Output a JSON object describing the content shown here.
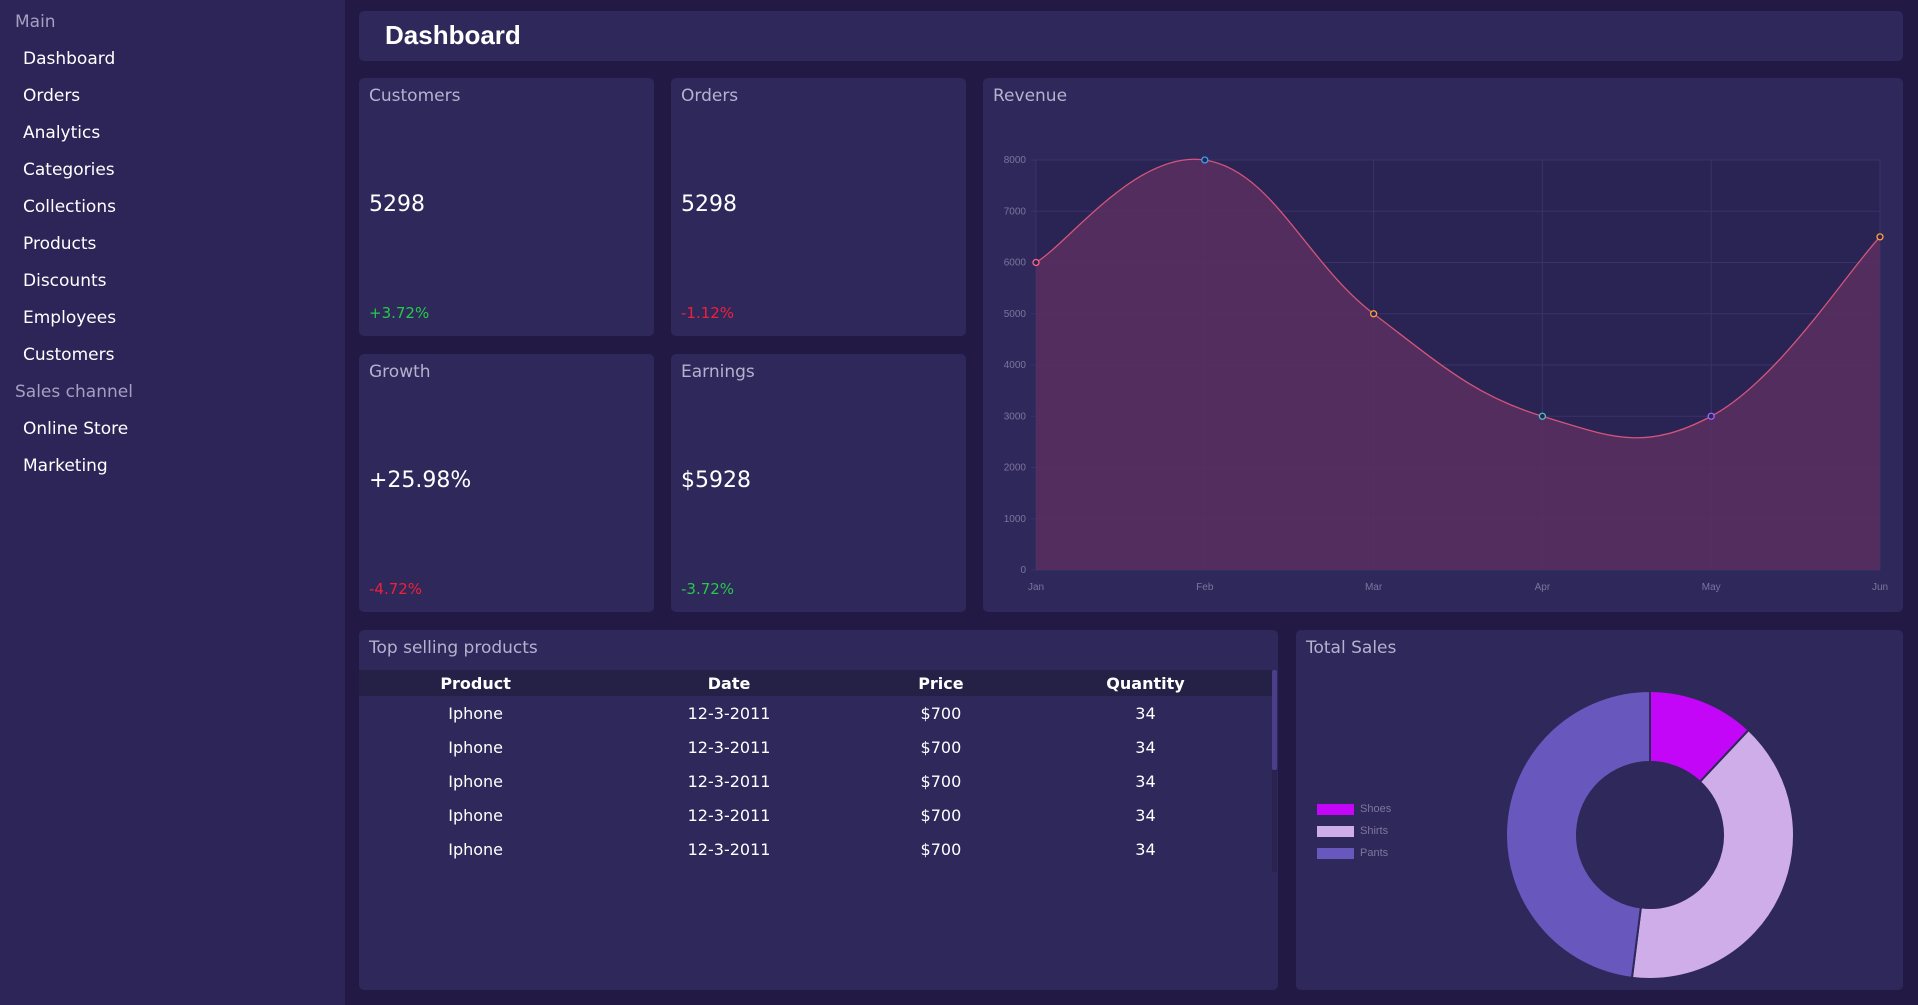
{
  "sidebar": {
    "sections": [
      {
        "title": "Main",
        "items": [
          "Dashboard",
          "Orders",
          "Analytics",
          "Categories",
          "Collections",
          "Products",
          "Discounts",
          "Employees",
          "Customers"
        ]
      },
      {
        "title": "Sales channel",
        "items": [
          "Online Store",
          "Marketing"
        ]
      }
    ]
  },
  "header": {
    "title": "Dashboard"
  },
  "stats": [
    {
      "title": "Customers",
      "value": "5298",
      "change": "+3.72%",
      "trend": "positive"
    },
    {
      "title": "Orders",
      "value": "5298",
      "change": "-1.12%",
      "trend": "negative"
    },
    {
      "title": "Growth",
      "value": "+25.98%",
      "change": "-4.72%",
      "trend": "negative"
    },
    {
      "title": "Earnings",
      "value": "$5928",
      "change": "-3.72%",
      "trend": "positive"
    }
  ],
  "revenue": {
    "title": "Revenue"
  },
  "top_products": {
    "title": "Top selling products",
    "columns": [
      "Product",
      "Date",
      "Price",
      "Quantity"
    ],
    "rows": [
      [
        "Iphone",
        "12-3-2011",
        "$700",
        "34"
      ],
      [
        "Iphone",
        "12-3-2011",
        "$700",
        "34"
      ],
      [
        "Iphone",
        "12-3-2011",
        "$700",
        "34"
      ],
      [
        "Iphone",
        "12-3-2011",
        "$700",
        "34"
      ],
      [
        "Iphone",
        "12-3-2011",
        "$700",
        "34"
      ]
    ]
  },
  "total_sales": {
    "title": "Total Sales"
  },
  "colors": {
    "positive": "#26c94a",
    "negative": "#f0203c",
    "line": "#d2557a",
    "fill": "#5a2f60",
    "shoes": "#c306f7",
    "shirts": "#ceade9",
    "pants": "#6857bc"
  },
  "chart_data": [
    {
      "type": "area",
      "title": "Revenue",
      "categories": [
        "Jan",
        "Feb",
        "Mar",
        "Apr",
        "May",
        "Jun"
      ],
      "values": [
        6000,
        8000,
        5000,
        3000,
        3000,
        6500
      ],
      "point_colors": [
        "#ff6384",
        "#36a2eb",
        "#ff9f40",
        "#4bc0c0",
        "#9966ff",
        "#ff9f40"
      ],
      "ylim": [
        0,
        8000
      ],
      "yticks": [
        0,
        1000,
        2000,
        3000,
        4000,
        5000,
        6000,
        7000,
        8000
      ],
      "grid": true
    },
    {
      "type": "pie",
      "style": "doughnut",
      "title": "Total Sales",
      "labels": [
        "Shoes",
        "Shirts",
        "Pants"
      ],
      "values": [
        12,
        40,
        48
      ],
      "legend": "left"
    }
  ]
}
